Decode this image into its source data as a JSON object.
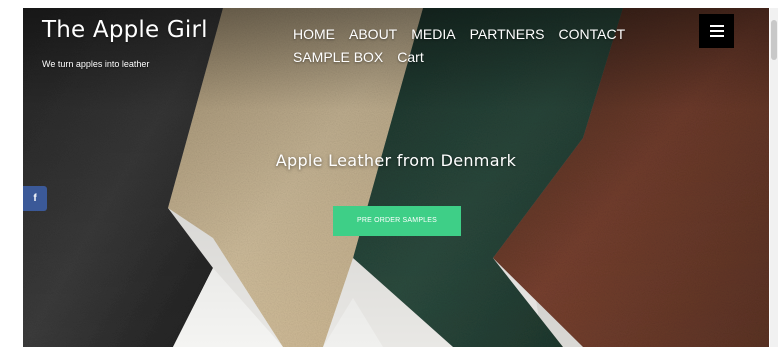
{
  "brand": {
    "title": "The Apple Girl",
    "tagline": "We turn apples into leather"
  },
  "nav": {
    "items": [
      {
        "label": "HOME"
      },
      {
        "label": "ABOUT"
      },
      {
        "label": "MEDIA"
      },
      {
        "label": "PARTNERS"
      },
      {
        "label": "CONTACT"
      },
      {
        "label": "SAMPLE BOX"
      },
      {
        "label": "Cart"
      }
    ]
  },
  "menu": {
    "icon": "hamburger-menu-icon"
  },
  "hero": {
    "heading": "Apple Leather from Denmark",
    "cta_label": "PRE ORDER SAMPLES"
  },
  "social": {
    "facebook_glyph": "f",
    "icon": "facebook-icon"
  },
  "colors": {
    "cta": "#3ecf87",
    "facebook": "#3b5998",
    "menu_button": "#000000",
    "text": "#ffffff"
  }
}
